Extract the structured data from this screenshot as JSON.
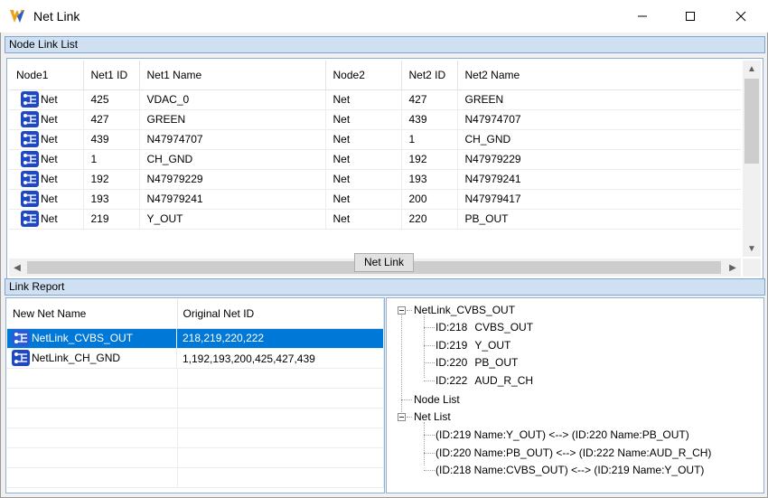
{
  "window": {
    "title": "Net Link"
  },
  "node_link_list": {
    "header": "Node Link List",
    "columns": [
      "Node1",
      "Net1 ID",
      "Net1 Name",
      "Node2",
      "Net2 ID",
      "Net2 Name"
    ],
    "rows": [
      {
        "node1": "Net",
        "net1_id": "425",
        "net1_name": "VDAC_0",
        "node2": "Net",
        "net2_id": "427",
        "net2_name": "GREEN"
      },
      {
        "node1": "Net",
        "net1_id": "427",
        "net1_name": "GREEN",
        "node2": "Net",
        "net2_id": "439",
        "net2_name": "N47974707"
      },
      {
        "node1": "Net",
        "net1_id": "439",
        "net1_name": "N47974707",
        "node2": "Net",
        "net2_id": "1",
        "net2_name": "CH_GND"
      },
      {
        "node1": "Net",
        "net1_id": "1",
        "net1_name": "CH_GND",
        "node2": "Net",
        "net2_id": "192",
        "net2_name": "N47979229"
      },
      {
        "node1": "Net",
        "net1_id": "192",
        "net1_name": "N47979229",
        "node2": "Net",
        "net2_id": "193",
        "net2_name": "N47979241"
      },
      {
        "node1": "Net",
        "net1_id": "193",
        "net1_name": "N47979241",
        "node2": "Net",
        "net2_id": "200",
        "net2_name": "N47979417"
      },
      {
        "node1": "Net",
        "net1_id": "219",
        "net1_name": "Y_OUT",
        "node2": "Net",
        "net2_id": "220",
        "net2_name": "PB_OUT"
      }
    ]
  },
  "net_link_button": "Net Link",
  "link_report": {
    "header": "Link Report",
    "columns": [
      "New Net Name",
      "Original Net ID"
    ],
    "rows": [
      {
        "name": "NetLink_CVBS_OUT",
        "ids": "218,219,220,222",
        "selected": true
      },
      {
        "name": "NetLink_CH_GND",
        "ids": "1,192,193,200,425,427,439",
        "selected": false
      }
    ],
    "tree": {
      "root": "NetLink_CVBS_OUT",
      "ids": [
        {
          "id": "ID:218",
          "name": "CVBS_OUT"
        },
        {
          "id": "ID:219",
          "name": "Y_OUT"
        },
        {
          "id": "ID:220",
          "name": "PB_OUT"
        },
        {
          "id": "ID:222",
          "name": "AUD_R_CH"
        }
      ],
      "node_list": "Node List",
      "net_list": "Net List",
      "links": [
        "(ID:219 Name:Y_OUT) <--> (ID:220 Name:PB_OUT)",
        "(ID:220 Name:PB_OUT) <--> (ID:222 Name:AUD_R_CH)",
        "(ID:218 Name:CVBS_OUT) <--> (ID:219 Name:Y_OUT)"
      ]
    }
  },
  "colors": {
    "accent": "#0078d7",
    "header_bg": "#cfe0f3",
    "net_icon": "#1f48c9"
  }
}
